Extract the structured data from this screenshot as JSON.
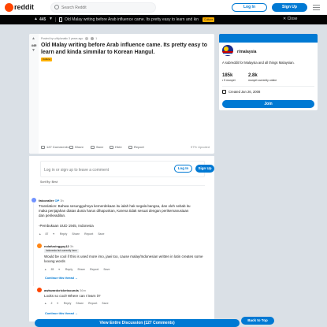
{
  "header": {
    "logo_text": "reddit",
    "search_placeholder": "Search Reddit",
    "login_label": "Log In",
    "signup_label": "Sign Up"
  },
  "darkbar": {
    "vote_count": "445",
    "title": "Old Malay writing before Arab influence came. Its pretty easy to learn and kinda si...",
    "flair": "Culture",
    "close_label": "Close"
  },
  "post": {
    "vote_count": "445",
    "meta": "Posted by u/diylunatic 3 years ago",
    "award_count": "1",
    "title": "Old Malay writing before Arab influence came. Its pretty easy to learn and kinda simmilar to Korean Hangul.",
    "flair": "Culture",
    "actions": {
      "comments": "127 Comments",
      "share": "Share",
      "save": "Save",
      "hide": "Hide",
      "report": "Report"
    },
    "upvoted": "97% Upvoted"
  },
  "comments_section": {
    "login_prompt": "Log in or sign up to leave a comment",
    "login_label": "Log In",
    "signup_label": "Sign Up",
    "sort_label": "Sort By: Best",
    "comments": [
      {
        "author": "fatcoraller",
        "op_badge": "OP",
        "time": "3h",
        "text_lines": [
          "Translation: Bahwa sesungguhnya kemerdekaan itu ialah hak segala bangsa, dan oleh sebab itu",
          "maka penjajahan diatas dunia harus dihapuskan, Karena tidak sesuai dengan perikemanusiaan",
          "dan perikeadilan."
        ],
        "text_line2": "-Pembukaan UUD 1945, Indonesia",
        "votes": "87",
        "actions": [
          "Reply",
          "Share",
          "Report",
          "Save"
        ]
      },
      {
        "author": "nolafusingguy12",
        "time": "3h",
        "flair": "Indonesia but currently here",
        "text": "Would be cool if this is used more imo, jawi too, cause malay/Indonesian written in latin creates some looong words",
        "votes": "35",
        "actions": [
          "Reply",
          "Share",
          "Report",
          "Save"
        ],
        "continue": "Continue this thread →"
      },
      {
        "author": "awkwardcricketsounds",
        "time": "36m",
        "text": "Looks so cool! Where can I learn it?",
        "votes": "2",
        "actions": [
          "Reply",
          "Share",
          "Report",
          "Save"
        ],
        "continue": "Continue this thread →"
      }
    ],
    "view_all": "View Entire Discussion (127 Comments)"
  },
  "sidebar": {
    "name": "r/malaysia",
    "description": "A subreddit for Malaysia and all things Malaysian.",
    "members": "185k",
    "members_label": "• 5 munyet",
    "online": "2.8k",
    "online_label": "munyet currently online",
    "created": "Created Jan 26, 2008",
    "join_label": "Join"
  },
  "back_to_top": "Back to Top",
  "colors": {
    "accent": "#0079d3",
    "orange": "#ff4500",
    "flair": "#ffb000",
    "background": "#dae0e6"
  }
}
